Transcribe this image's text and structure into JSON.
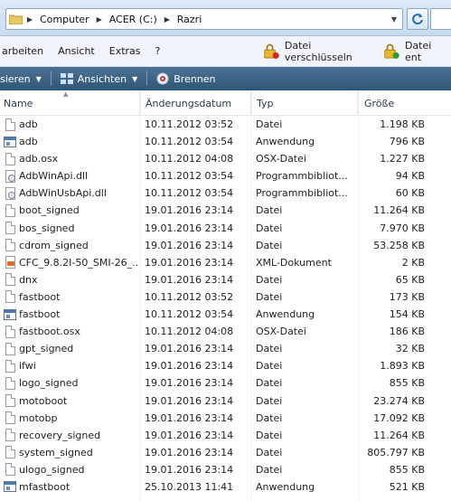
{
  "address_bar": {
    "crumbs": [
      "Computer",
      "ACER (C:)",
      "Razri"
    ]
  },
  "menu": {
    "items": [
      "arbeiten",
      "Ansicht",
      "Extras",
      "?"
    ],
    "encrypt_label": "Datei verschlüsseln",
    "decrypt_label": "Datei ent"
  },
  "commandbar": {
    "organize_label": "sieren",
    "views_label": "Ansichten",
    "burn_label": "Brennen"
  },
  "columns": {
    "name": "Name",
    "date": "Änderungsdatum",
    "type": "Typ",
    "size": "Größe"
  },
  "files": [
    {
      "icon": "file-icon",
      "name": "adb",
      "date": "10.11.2012 03:52",
      "type": "Datei",
      "size": "1.198 KB"
    },
    {
      "icon": "application-icon",
      "name": "adb",
      "date": "10.11.2012 03:54",
      "type": "Anwendung",
      "size": "796 KB"
    },
    {
      "icon": "file-icon",
      "name": "adb.osx",
      "date": "10.11.2012 04:08",
      "type": "OSX-Datei",
      "size": "1.227 KB"
    },
    {
      "icon": "dll-icon",
      "name": "AdbWinApi.dll",
      "date": "10.11.2012 03:54",
      "type": "Programmbibliot...",
      "size": "94 KB"
    },
    {
      "icon": "dll-icon",
      "name": "AdbWinUsbApi.dll",
      "date": "10.11.2012 03:54",
      "type": "Programmbibliot...",
      "size": "60 KB"
    },
    {
      "icon": "file-icon",
      "name": "boot_signed",
      "date": "19.01.2016 23:14",
      "type": "Datei",
      "size": "11.264 KB"
    },
    {
      "icon": "file-icon",
      "name": "bos_signed",
      "date": "19.01.2016 23:14",
      "type": "Datei",
      "size": "7.970 KB"
    },
    {
      "icon": "file-icon",
      "name": "cdrom_signed",
      "date": "19.01.2016 23:14",
      "type": "Datei",
      "size": "53.258 KB"
    },
    {
      "icon": "xml-icon",
      "name": "CFC_9.8.2I-50_SMI-26_...",
      "date": "19.01.2016 23:14",
      "type": "XML-Dokument",
      "size": "2 KB"
    },
    {
      "icon": "file-icon",
      "name": "dnx",
      "date": "19.01.2016 23:14",
      "type": "Datei",
      "size": "65 KB"
    },
    {
      "icon": "file-icon",
      "name": "fastboot",
      "date": "10.11.2012 03:52",
      "type": "Datei",
      "size": "173 KB"
    },
    {
      "icon": "application-icon",
      "name": "fastboot",
      "date": "10.11.2012 03:54",
      "type": "Anwendung",
      "size": "154 KB"
    },
    {
      "icon": "file-icon",
      "name": "fastboot.osx",
      "date": "10.11.2012 04:08",
      "type": "OSX-Datei",
      "size": "186 KB"
    },
    {
      "icon": "file-icon",
      "name": "gpt_signed",
      "date": "19.01.2016 23:14",
      "type": "Datei",
      "size": "32 KB"
    },
    {
      "icon": "file-icon",
      "name": "ifwi",
      "date": "19.01.2016 23:14",
      "type": "Datei",
      "size": "1.893 KB"
    },
    {
      "icon": "file-icon",
      "name": "logo_signed",
      "date": "19.01.2016 23:14",
      "type": "Datei",
      "size": "855 KB"
    },
    {
      "icon": "file-icon",
      "name": "motoboot",
      "date": "19.01.2016 23:14",
      "type": "Datei",
      "size": "23.274 KB"
    },
    {
      "icon": "file-icon",
      "name": "motobp",
      "date": "19.01.2016 23:14",
      "type": "Datei",
      "size": "17.092 KB"
    },
    {
      "icon": "file-icon",
      "name": "recovery_signed",
      "date": "19.01.2016 23:14",
      "type": "Datei",
      "size": "11.264 KB"
    },
    {
      "icon": "file-icon",
      "name": "system_signed",
      "date": "19.01.2016 23:14",
      "type": "Datei",
      "size": "805.797 KB"
    },
    {
      "icon": "file-icon",
      "name": "ulogo_signed",
      "date": "19.01.2016 23:14",
      "type": "Datei",
      "size": "855 KB"
    },
    {
      "icon": "application-icon",
      "name": "mfastboot",
      "date": "25.10.2013 11:41",
      "type": "Anwendung",
      "size": "521 KB"
    }
  ]
}
